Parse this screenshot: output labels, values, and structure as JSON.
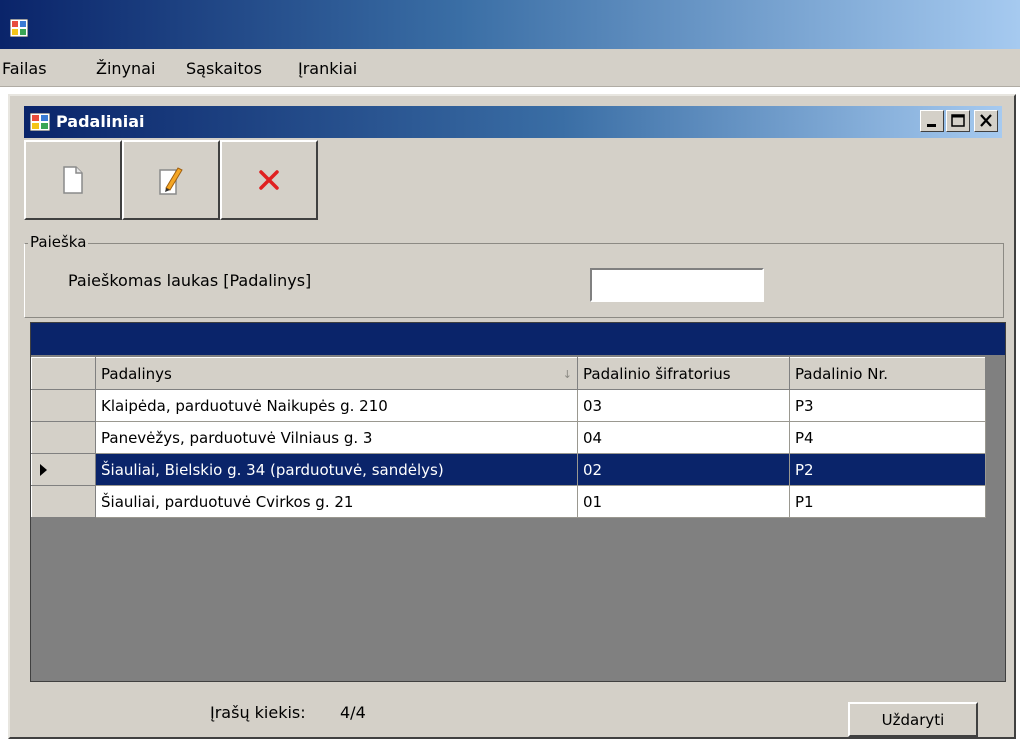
{
  "menu": {
    "items": [
      "Failas",
      "Žinynai",
      "Sąskaitos",
      "Įrankiai"
    ]
  },
  "window": {
    "title": "Padaliniai"
  },
  "toolbar": {
    "icons": [
      "new-document-icon",
      "edit-pencil-icon",
      "delete-x-icon"
    ]
  },
  "search": {
    "legend": "Paieška",
    "field_label": "Paieškomas laukas [Padalinys]",
    "value": ""
  },
  "grid": {
    "columns": [
      "Padalinys",
      "Padalinio šifratorius",
      "Padalinio Nr."
    ],
    "sort_glyph": "↓",
    "rows": [
      [
        "Klaipėda, parduotuvė Naikupės g. 210",
        "03",
        "P3"
      ],
      [
        "Panevėžys, parduotuvė Vilniaus g. 3",
        "04",
        "P4"
      ],
      [
        "Šiauliai, Bielskio g. 34 (parduotuvė, sandėlys)",
        "02",
        "P2"
      ],
      [
        "Šiauliai, parduotuvė Cvirkos g. 21",
        "01",
        "P1"
      ]
    ],
    "selected_row": 2
  },
  "footer": {
    "count_label": "Įrašų kiekis:",
    "count_value": "4/4",
    "close_label": "Uždaryti"
  },
  "colors": {
    "title_dark": "#0a246a",
    "face": "#d4d0c8",
    "grid_bg": "#808080"
  }
}
